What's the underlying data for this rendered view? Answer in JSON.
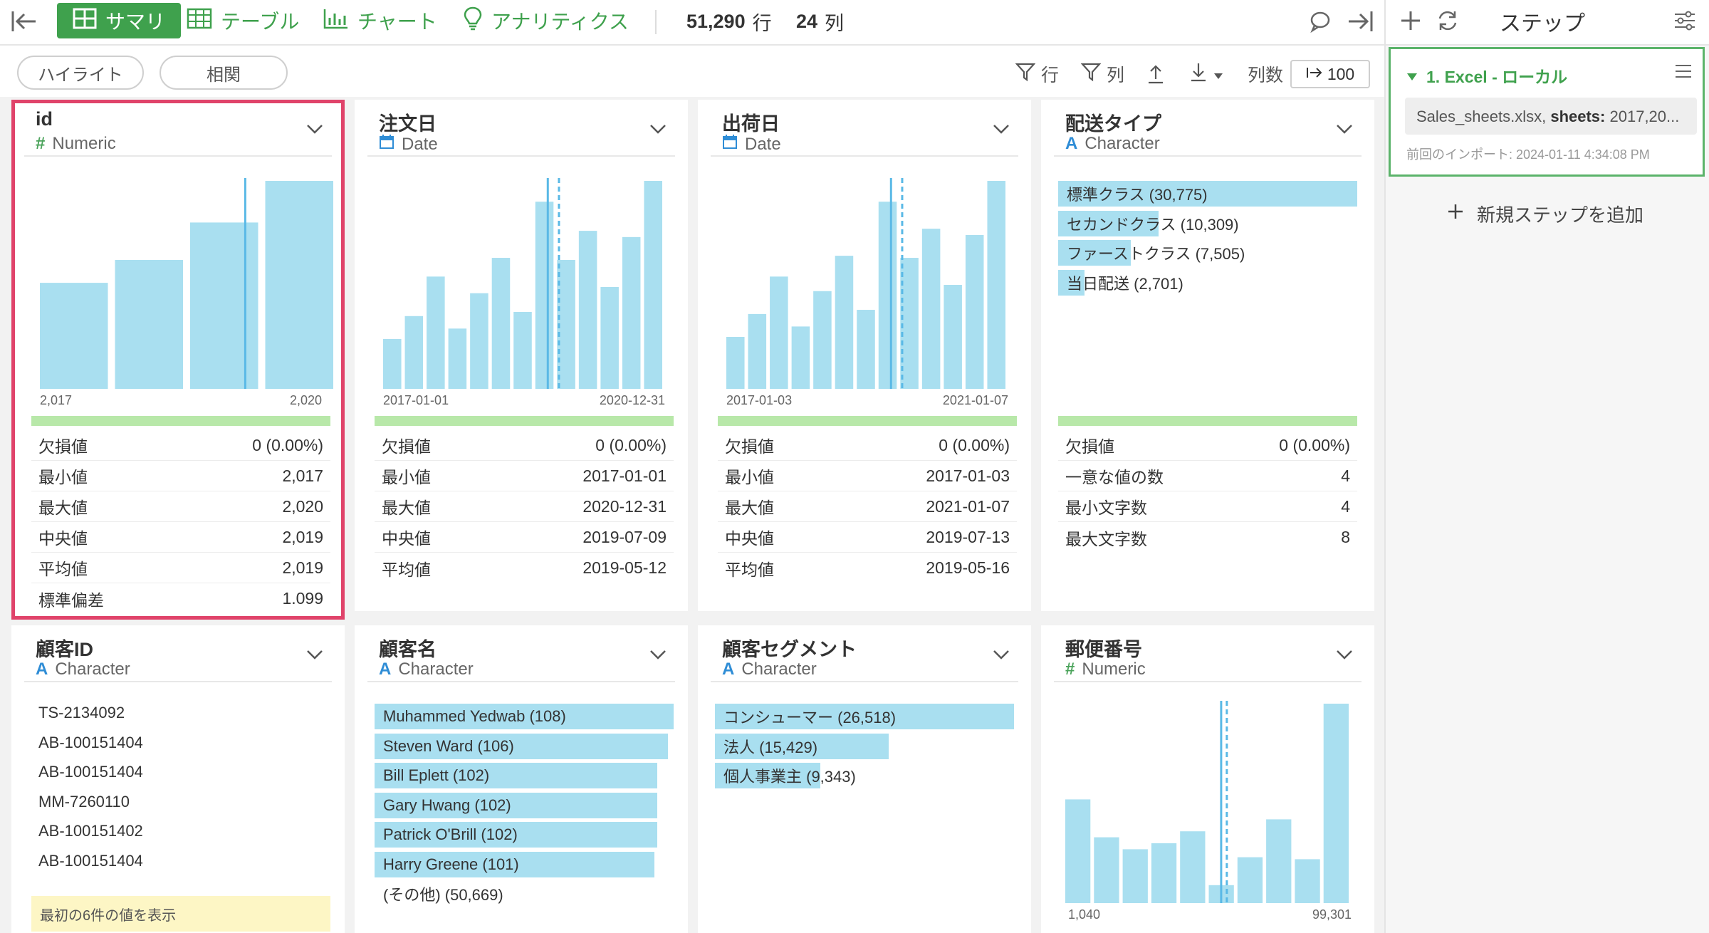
{
  "toolbar": {
    "tabs": [
      {
        "label": "サマリ",
        "icon": "grid-icon",
        "active": true
      },
      {
        "label": "テーブル",
        "icon": "table-icon"
      },
      {
        "label": "チャート",
        "icon": "bar-chart-icon"
      },
      {
        "label": "アナリティクス",
        "icon": "lightbulb-icon"
      }
    ],
    "rows_count": "51,290",
    "rows_unit": "行",
    "cols_count": "24",
    "cols_unit": "列"
  },
  "subtoolbar": {
    "highlight_label": "ハイライト",
    "correlation_label": "相関",
    "row_filter_label": "行",
    "col_filter_label": "列",
    "col_count_label": "列数",
    "col_count_value": "100"
  },
  "right_panel": {
    "title": "ステップ",
    "step": {
      "title": "1. Excel - ローカル",
      "file_name": "Sales_sheets.xlsx,",
      "sheets_label": "sheets:",
      "sheets_value": "2017,20...",
      "last_import": "前回のインポート: 2024-01-11 4:34:08 PM"
    },
    "add_step_label": "新規ステップを追加"
  },
  "colors": {
    "accent": "#3fa14d",
    "bar": "#a9dff0",
    "selected_outline": "#e0436a",
    "marker": "#5ab9e6"
  },
  "cards": {
    "id": {
      "name": "id",
      "type_icon": "#",
      "type": "Numeric",
      "hist": {
        "values": [
          0.51,
          0.62,
          0.8,
          1.0
        ],
        "marker_solid": 0.7
      },
      "axis_min": "2,017",
      "axis_max": "2,020",
      "stats": [
        [
          "欠損値",
          "0 (0.00%)"
        ],
        [
          "最小値",
          "2,017"
        ],
        [
          "最大値",
          "2,020"
        ],
        [
          "中央値",
          "2,019"
        ],
        [
          "平均値",
          "2,019"
        ],
        [
          "標準偏差",
          "1.099"
        ]
      ]
    },
    "order_date": {
      "name": "注文日",
      "type": "Date",
      "hist": {
        "values": [
          0.24,
          0.35,
          0.54,
          0.29,
          0.46,
          0.63,
          0.37,
          0.9,
          0.62,
          0.76,
          0.49,
          0.73,
          1.0
        ],
        "marker_solid": 0.59,
        "marker_dashed": 0.63
      },
      "axis_min": "2017-01-01",
      "axis_max": "2020-12-31",
      "stats": [
        [
          "欠損値",
          "0 (0.00%)"
        ],
        [
          "最小値",
          "2017-01-01"
        ],
        [
          "最大値",
          "2020-12-31"
        ],
        [
          "中央値",
          "2019-07-09"
        ],
        [
          "平均値",
          "2019-05-12"
        ]
      ]
    },
    "ship_date": {
      "name": "出荷日",
      "type": "Date",
      "hist": {
        "values": [
          0.25,
          0.36,
          0.54,
          0.3,
          0.47,
          0.64,
          0.38,
          0.9,
          0.63,
          0.77,
          0.5,
          0.74,
          1.0
        ],
        "marker_solid": 0.59,
        "marker_dashed": 0.63
      },
      "axis_min": "2017-01-03",
      "axis_max": "2021-01-07",
      "stats": [
        [
          "欠損値",
          "0 (0.00%)"
        ],
        [
          "最小値",
          "2017-01-03"
        ],
        [
          "最大値",
          "2021-01-07"
        ],
        [
          "中央値",
          "2019-07-13"
        ],
        [
          "平均値",
          "2019-05-16"
        ]
      ]
    },
    "ship_type": {
      "name": "配送タイプ",
      "type_icon": "A",
      "type": "Character",
      "categories": [
        {
          "label": "標準クラス (30,775)",
          "value": 30775
        },
        {
          "label": "セカンドクラス (10,309)",
          "value": 10309
        },
        {
          "label": "ファーストクラス (7,505)",
          "value": 7505
        },
        {
          "label": "当日配送 (2,701)",
          "value": 2701
        }
      ],
      "stats": [
        [
          "欠損値",
          "0 (0.00%)"
        ],
        [
          "一意な値の数",
          "4"
        ],
        [
          "最小文字数",
          "4"
        ],
        [
          "最大文字数",
          "8"
        ]
      ]
    },
    "customer_id": {
      "name": "顧客ID",
      "type": "Character",
      "values": [
        "TS-2134092",
        "AB-100151404",
        "AB-100151404",
        "MM-7260110",
        "AB-100151402",
        "AB-100151404"
      ],
      "note": "最初の6件の値を表示"
    },
    "customer_name": {
      "name": "顧客名",
      "type": "Character",
      "categories": [
        {
          "label": "Muhammed Yedwab (108)",
          "value": 108
        },
        {
          "label": "Steven Ward (106)",
          "value": 106
        },
        {
          "label": "Bill Eplett (102)",
          "value": 102
        },
        {
          "label": "Gary Hwang (102)",
          "value": 102
        },
        {
          "label": "Patrick O'Brill (102)",
          "value": 102
        },
        {
          "label": "Harry Greene (101)",
          "value": 101
        }
      ],
      "other": "(その他) (50,669)"
    },
    "segment": {
      "name": "顧客セグメント",
      "type": "Character",
      "categories": [
        {
          "label": "コンシューマー (26,518)",
          "value": 26518
        },
        {
          "label": "法人 (15,429)",
          "value": 15429
        },
        {
          "label": "個人事業主 (9,343)",
          "value": 9343
        }
      ]
    },
    "postal": {
      "name": "郵便番号",
      "type": "Numeric",
      "hist": {
        "values": [
          0.52,
          0.33,
          0.27,
          0.3,
          0.36,
          0.09,
          0.23,
          0.42,
          0.22,
          1.0
        ],
        "marker_solid": 0.55,
        "marker_dashed": 0.57
      },
      "axis_min": "1,040",
      "axis_max": "99,301"
    }
  }
}
